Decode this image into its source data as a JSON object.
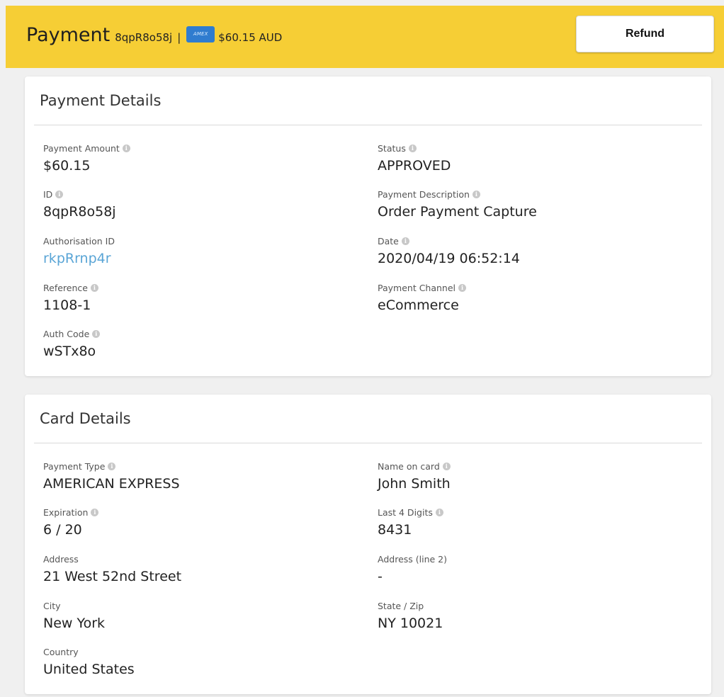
{
  "header": {
    "title": "Payment",
    "payment_id": "8qpR8o58j",
    "separator": "|",
    "card_brand_icon": "amex-card-icon",
    "card_brand_text": "AMEX",
    "amount": "$60.15 AUD",
    "refund_label": "Refund"
  },
  "payment_details": {
    "title": "Payment Details",
    "payment_amount_label": "Payment Amount",
    "payment_amount_value": "$60.15",
    "id_label": "ID",
    "id_value": "8qpR8o58j",
    "authorisation_id_label": "Authorisation ID",
    "authorisation_id_value": "rkpRrnp4r",
    "reference_label": "Reference",
    "reference_value": "1108-1",
    "auth_code_label": "Auth Code",
    "auth_code_value": "wSTx8o",
    "status_label": "Status",
    "status_value": "APPROVED",
    "description_label": "Payment Description",
    "description_value": "Order Payment Capture",
    "date_label": "Date",
    "date_value": "2020/04/19 06:52:14",
    "channel_label": "Payment Channel",
    "channel_value": "eCommerce"
  },
  "card_details": {
    "title": "Card Details",
    "payment_type_label": "Payment Type",
    "payment_type_value": "AMERICAN EXPRESS",
    "expiration_label": "Expiration",
    "expiration_value": "6 / 20",
    "address_label": "Address",
    "address_value": "21 West 52nd Street",
    "city_label": "City",
    "city_value": "New York",
    "country_label": "Country",
    "country_value": "United States",
    "name_label": "Name on card",
    "name_value": "John Smith",
    "last4_label": "Last 4 Digits",
    "last4_value": "8431",
    "address2_label": "Address (line 2)",
    "address2_value": "-",
    "state_zip_label": "State / Zip",
    "state_zip_value": "NY 10021"
  },
  "colors": {
    "header_bg": "#f6ce35",
    "link": "#5aa5d6",
    "amex_blue": "#2f7ccf"
  }
}
